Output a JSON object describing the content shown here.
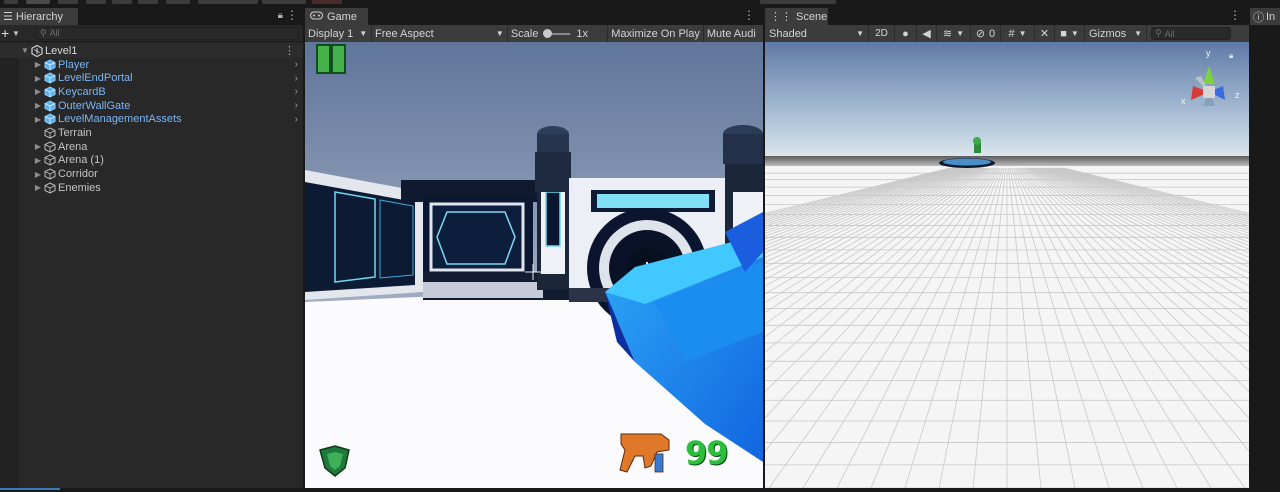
{
  "hierarchy": {
    "tab_label": "Hierarchy",
    "search_placeholder": "All",
    "root": "Level1",
    "items": [
      {
        "label": "Player",
        "prefab": true,
        "expandable": true
      },
      {
        "label": "LevelEndPortal",
        "prefab": true,
        "expandable": true
      },
      {
        "label": "KeycardB",
        "prefab": true,
        "expandable": true
      },
      {
        "label": "OuterWallGate",
        "prefab": true,
        "expandable": true
      },
      {
        "label": "LevelManagementAssets",
        "prefab": true,
        "expandable": true
      },
      {
        "label": "Terrain",
        "prefab": false,
        "expandable": false
      },
      {
        "label": "Arena",
        "prefab": false,
        "expandable": true
      },
      {
        "label": "Arena (1)",
        "prefab": false,
        "expandable": true
      },
      {
        "label": "Corridor",
        "prefab": false,
        "expandable": true
      },
      {
        "label": "Enemies",
        "prefab": false,
        "expandable": true
      }
    ]
  },
  "game": {
    "tab_label": "Game",
    "display": "Display 1",
    "aspect": "Free Aspect",
    "scale_label": "Scale",
    "scale_value": "1x",
    "maximize": "Maximize On Play",
    "mute": "Mute Audi",
    "ammo": "99"
  },
  "scene": {
    "tab_label": "Scene",
    "shading": "Shaded",
    "mode_2d": "2D",
    "hidden_count": "0",
    "gizmos": "Gizmos",
    "search_placeholder": "All",
    "gizmo_axes": {
      "y": "y",
      "x": "x",
      "z": "z"
    }
  },
  "right_panel": {
    "tab_label": "In"
  },
  "colors": {
    "prefab": "#7ab5f3",
    "panel": "#282828",
    "toolbar": "#3c3c3c",
    "accent": "#3a79bb"
  }
}
